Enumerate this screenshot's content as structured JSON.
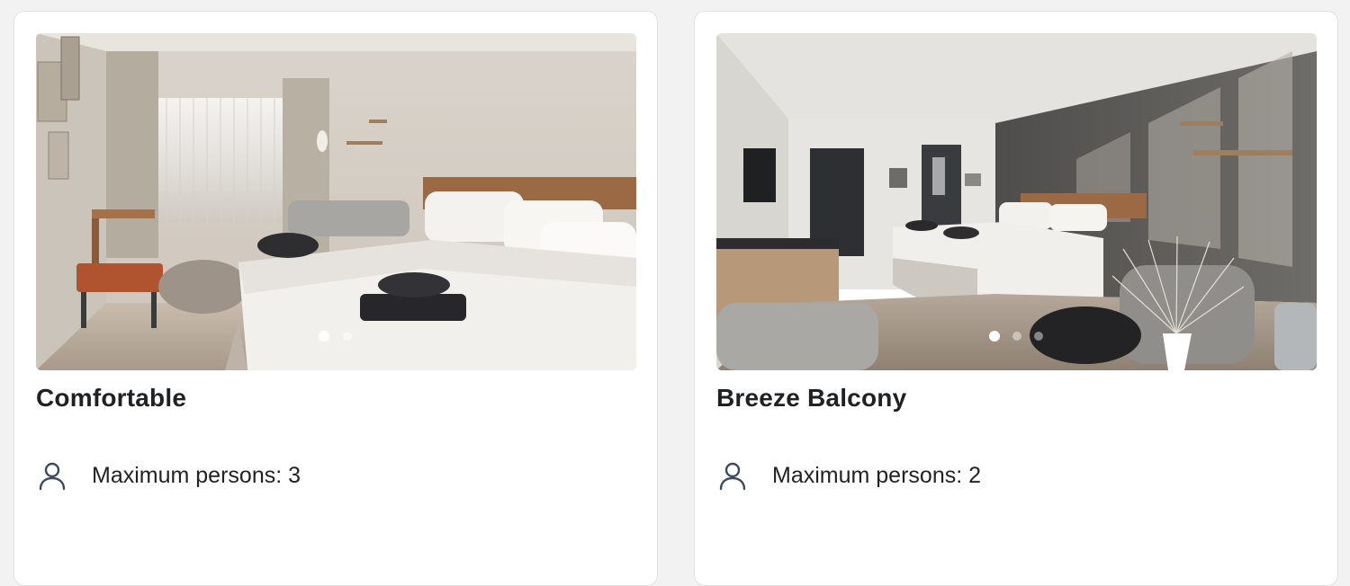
{
  "rooms": [
    {
      "title": "Comfortable",
      "capacity_text": "Maximum persons: 3",
      "image_alt": "Comfortable room with double bed, armchair and window",
      "carousel": {
        "slide_count": 2,
        "active_index": 0
      }
    },
    {
      "title": "Breeze Balcony",
      "capacity_text": "Maximum persons: 2",
      "image_alt": "Breeze Balcony room with double bed, grey accent wall and armchair",
      "carousel": {
        "slide_count": 3,
        "active_index": 0
      }
    }
  ],
  "icons": {
    "capacity": "person-icon"
  },
  "colors": {
    "page_background": "#f2f2f3",
    "card_background": "#ffffff",
    "text_primary": "#1f2124",
    "icon_color": "#3b4a5c"
  }
}
